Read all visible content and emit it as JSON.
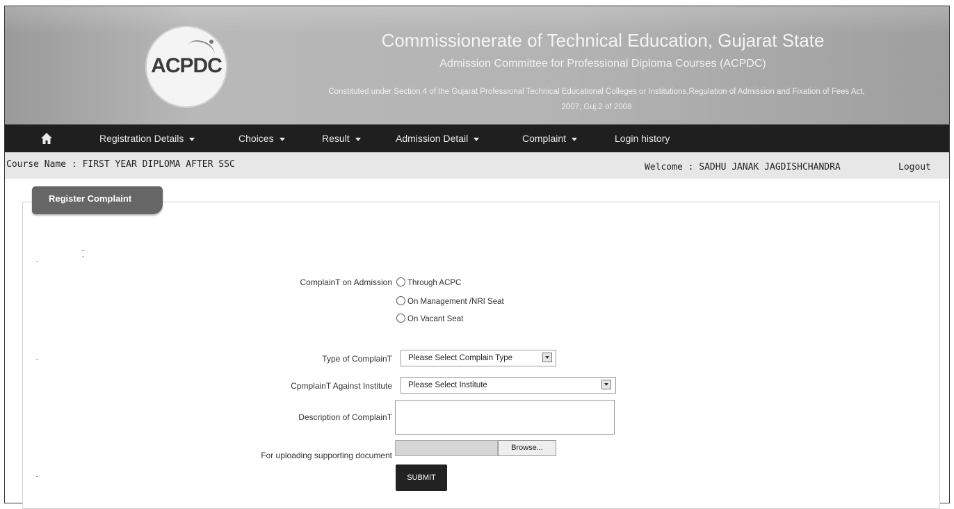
{
  "header": {
    "logo_text": "ACPDC",
    "title": "Commissionerate of Technical Education, Gujarat State",
    "subtitle": "Admission Committee for Professional Diploma Courses (ACPDC)",
    "law_line1": "Constituted under Section 4 of the Gujarat Professional Technical Educational Colleges or Institutions,Regulation of Admission and Fixation of Fees Act,",
    "law_line2": "2007, Guj.2 of 2008"
  },
  "nav": {
    "home_icon": "home-icon",
    "items": [
      {
        "label": "Registration Details",
        "dropdown": true
      },
      {
        "label": "Choices",
        "dropdown": true
      },
      {
        "label": "Result",
        "dropdown": true
      },
      {
        "label": "Admission Detail",
        "dropdown": true
      },
      {
        "label": "Complaint",
        "dropdown": true
      },
      {
        "label": "Login history",
        "dropdown": false
      }
    ]
  },
  "infobar": {
    "course": "Course Name : FIRST YEAR DIPLOMA AFTER SSC",
    "welcome": "Welcome : SADHU JANAK JAGDISHCHANDRA",
    "logout": "Logout"
  },
  "form": {
    "panel_title": "Register Complaint",
    "complaint_on_label": "ComplainT on Admission",
    "options": [
      "Through ACPC",
      "On Management /NRI Seat",
      "On Vacant Seat"
    ],
    "type_label": "Type of ComplainT",
    "type_value": "Please Select Complain Type",
    "against_label": "CpmplainT Against Institute",
    "against_value": "Please Select Institute",
    "description_label": "Description of ComplainT",
    "upload_label": "For uploading supporting document",
    "browse_label": "Browse...",
    "submit_label": "SUBMIT"
  },
  "colors": {
    "header_bg": "#b0b0b0",
    "navbar_bg": "#1f1f1f",
    "infobar_bg": "#e7e7e7",
    "tab_bg": "#666666",
    "submit_bg": "#222222"
  }
}
